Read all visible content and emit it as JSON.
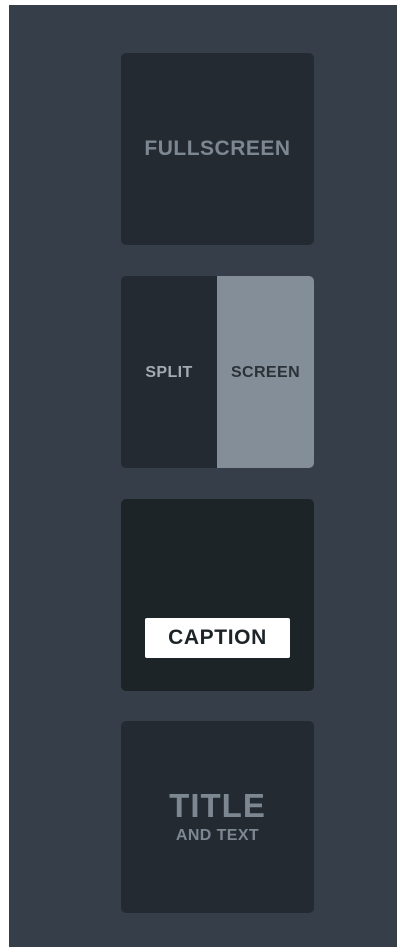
{
  "layouts": {
    "fullscreen": {
      "label": "FULLSCREEN"
    },
    "split_screen": {
      "left_label": "SPLIT",
      "right_label": "SCREEN"
    },
    "caption": {
      "label": "CAPTION"
    },
    "title_and_text": {
      "title": "TITLE",
      "subtitle": "AND TEXT"
    }
  },
  "colors": {
    "panel_background": "#363f49",
    "tile_background": "#232a31",
    "caption_tile_background": "#1d2428",
    "split_highlight": "#848e98",
    "label_text": "#7d8792"
  }
}
